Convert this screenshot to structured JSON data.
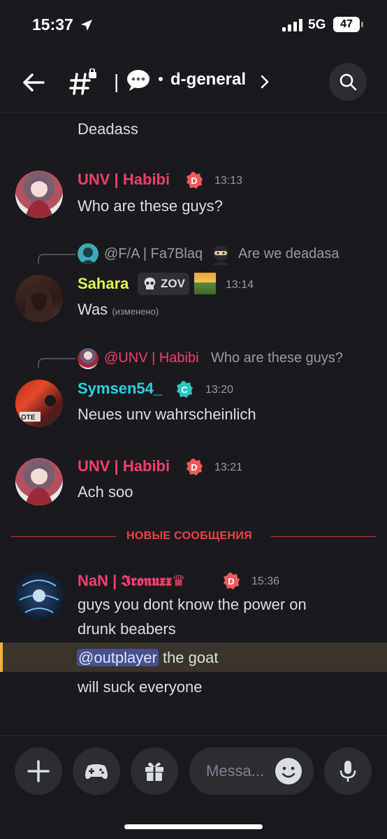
{
  "status_bar": {
    "time": "15:37",
    "network": "5G",
    "battery": "47"
  },
  "header": {
    "channel_name": "d-general"
  },
  "messages": {
    "m0": {
      "text": "Deadass"
    },
    "m1": {
      "username": "UNV | Habibi",
      "time": "13:13",
      "text": "Who are these guys?",
      "name_color": "#f23f6c"
    },
    "m2": {
      "reply_user": "@F/A | Fa7Blaq",
      "reply_text": "Are we deadasa",
      "username": "Sahara",
      "tag": "ZOV",
      "time": "13:14",
      "text": "Was",
      "edited": "(изменено)",
      "name_color": "#e2f542"
    },
    "m3": {
      "reply_user": "@UNV | Habibi",
      "reply_text": "Who are these guys?",
      "username": "Symsen54_",
      "time": "13:20",
      "text": "Neues unv wahrscheinlich",
      "name_color": "#25d3e6"
    },
    "m4": {
      "username": "UNV | Habibi",
      "time": "13:21",
      "text": "Ach soo"
    },
    "new_messages_label": "НОВЫЕ СООБЩЕНИЯ",
    "m5": {
      "username": "NaN | 𝕴𝖗𝖔𝖓𝖚𝖝𝖝♛",
      "time": "15:36",
      "text_line1": "guys you dont know the power on",
      "text_line2": "drunk beabers",
      "mention": "@outplayer",
      "mention_rest": " the goat",
      "text_line4": "will suck everyone"
    }
  },
  "composer": {
    "placeholder": "Messa..."
  },
  "colors": {
    "background": "#1a1a1e",
    "accent_red": "#f23f43"
  }
}
